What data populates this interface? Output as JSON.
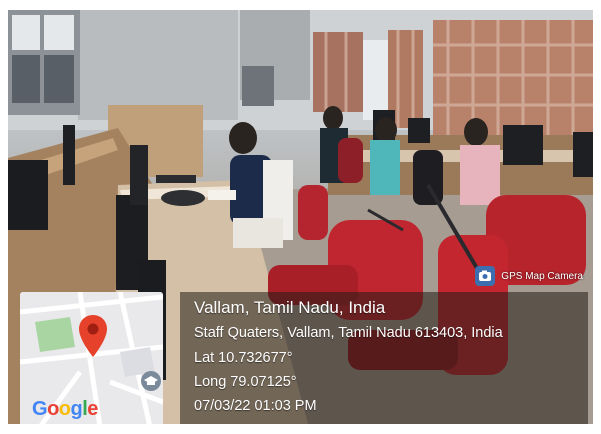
{
  "photo": {
    "description_icon": "photo-scene",
    "colors": {
      "panel_bg": "#231c16",
      "text": "#ffffff",
      "map_bg": "#e9e9ec",
      "pin": "#e5412b",
      "green_area": "#a8d5a2"
    }
  },
  "badge": {
    "label": "GPS Map Camera",
    "icon": "camera-icon"
  },
  "map": {
    "logo_letters": [
      "G",
      "o",
      "o",
      "g",
      "l",
      "e"
    ],
    "logo_colors": [
      "#4285F4",
      "#EA4335",
      "#FBBC05",
      "#4285F4",
      "#34A853",
      "#EA4335"
    ],
    "pin_icon": "location-pin-icon",
    "cap_icon": "graduation-cap-icon"
  },
  "info": {
    "place": "Vallam, Tamil Nadu, India",
    "address": "Staff Quaters, Vallam, Tamil Nadu 613403, India",
    "lat": "Lat 10.732677°",
    "long": "Long 79.07125°",
    "datetime": "07/03/22 01:03 PM"
  }
}
